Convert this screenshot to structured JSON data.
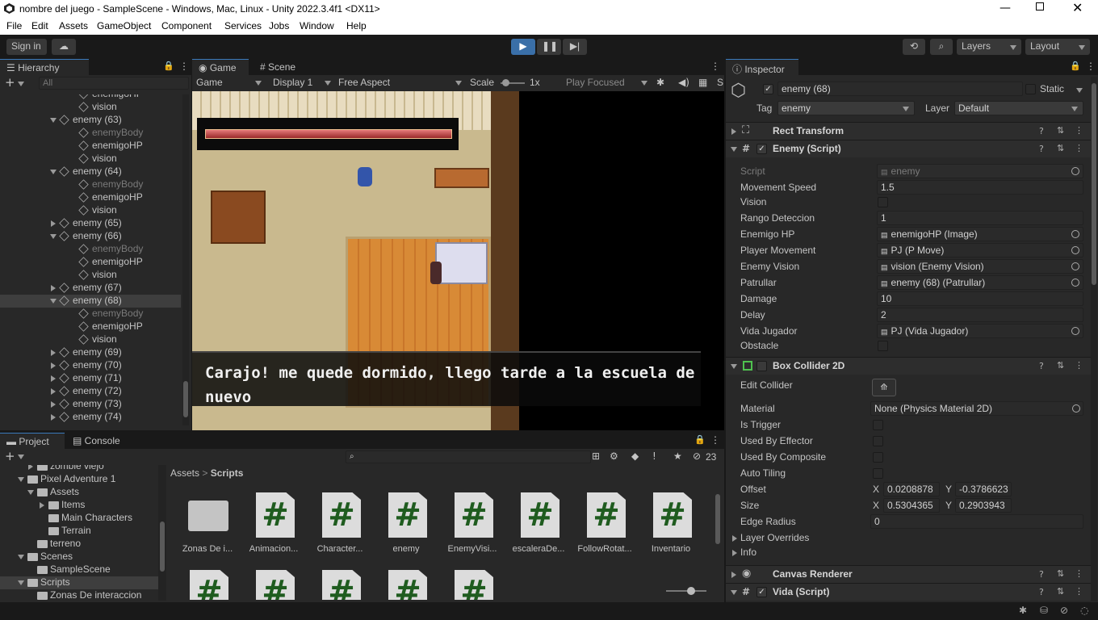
{
  "window": {
    "title": "nombre del juego - SampleScene - Windows, Mac, Linux - Unity 2022.3.4f1 <DX11>"
  },
  "menu": [
    "File",
    "Edit",
    "Assets",
    "GameObject",
    "Component",
    "Services",
    "Jobs",
    "Window",
    "Help"
  ],
  "toolbar": {
    "signin": "Sign in",
    "layers": "Layers",
    "layout": "Layout"
  },
  "hierarchy": {
    "tab": "Hierarchy",
    "search_placeholder": "All",
    "rows": [
      {
        "label": "enemigoHP",
        "indent": 2,
        "dim": false,
        "arrow": "none",
        "selected": false
      },
      {
        "label": "vision",
        "indent": 2,
        "dim": false,
        "arrow": "none",
        "selected": false
      },
      {
        "label": "enemy (63)",
        "indent": 1,
        "dim": false,
        "arrow": "down",
        "selected": false
      },
      {
        "label": "enemyBody",
        "indent": 2,
        "dim": true,
        "arrow": "none",
        "selected": false
      },
      {
        "label": "enemigoHP",
        "indent": 2,
        "dim": false,
        "arrow": "none",
        "selected": false
      },
      {
        "label": "vision",
        "indent": 2,
        "dim": false,
        "arrow": "none",
        "selected": false
      },
      {
        "label": "enemy (64)",
        "indent": 1,
        "dim": false,
        "arrow": "down",
        "selected": false
      },
      {
        "label": "enemyBody",
        "indent": 2,
        "dim": true,
        "arrow": "none",
        "selected": false
      },
      {
        "label": "enemigoHP",
        "indent": 2,
        "dim": false,
        "arrow": "none",
        "selected": false
      },
      {
        "label": "vision",
        "indent": 2,
        "dim": false,
        "arrow": "none",
        "selected": false
      },
      {
        "label": "enemy (65)",
        "indent": 1,
        "dim": false,
        "arrow": "right",
        "selected": false
      },
      {
        "label": "enemy (66)",
        "indent": 1,
        "dim": false,
        "arrow": "down",
        "selected": false
      },
      {
        "label": "enemyBody",
        "indent": 2,
        "dim": true,
        "arrow": "none",
        "selected": false
      },
      {
        "label": "enemigoHP",
        "indent": 2,
        "dim": false,
        "arrow": "none",
        "selected": false
      },
      {
        "label": "vision",
        "indent": 2,
        "dim": false,
        "arrow": "none",
        "selected": false
      },
      {
        "label": "enemy (67)",
        "indent": 1,
        "dim": false,
        "arrow": "right",
        "selected": false
      },
      {
        "label": "enemy (68)",
        "indent": 1,
        "dim": false,
        "arrow": "down",
        "selected": true
      },
      {
        "label": "enemyBody",
        "indent": 2,
        "dim": true,
        "arrow": "none",
        "selected": false
      },
      {
        "label": "enemigoHP",
        "indent": 2,
        "dim": false,
        "arrow": "none",
        "selected": false
      },
      {
        "label": "vision",
        "indent": 2,
        "dim": false,
        "arrow": "none",
        "selected": false
      },
      {
        "label": "enemy (69)",
        "indent": 1,
        "dim": false,
        "arrow": "right",
        "selected": false
      },
      {
        "label": "enemy (70)",
        "indent": 1,
        "dim": false,
        "arrow": "right",
        "selected": false
      },
      {
        "label": "enemy (71)",
        "indent": 1,
        "dim": false,
        "arrow": "right",
        "selected": false
      },
      {
        "label": "enemy (72)",
        "indent": 1,
        "dim": false,
        "arrow": "right",
        "selected": false
      },
      {
        "label": "enemy (73)",
        "indent": 1,
        "dim": false,
        "arrow": "right",
        "selected": false
      },
      {
        "label": "enemy (74)",
        "indent": 1,
        "dim": false,
        "arrow": "right",
        "selected": false
      }
    ]
  },
  "game": {
    "tabs": [
      "Game",
      "Scene"
    ],
    "display_mode": "Game",
    "display": "Display 1",
    "aspect": "Free Aspect",
    "scale_label": "Scale",
    "scale_value": "1x",
    "play_focused": "Play Focused",
    "stats_cut": "S",
    "dialog": "Carajo! me quede dormido, llego tarde a la escuela de nuevo"
  },
  "inspector": {
    "tab": "Inspector",
    "object_name": "enemy (68)",
    "static_label": "Static",
    "tag_label": "Tag",
    "tag": "enemy",
    "layer_label": "Layer",
    "layer": "Default",
    "components": {
      "rect": "Rect Transform",
      "enemy": "Enemy (Script)",
      "box": "Box Collider 2D",
      "canvas": "Canvas Renderer",
      "vida": "Vida (Script)"
    },
    "enemy_fields": [
      {
        "label": "Script",
        "value": "enemy",
        "kind": "ref",
        "dim": true
      },
      {
        "label": "Movement Speed",
        "value": "1.5",
        "kind": "text",
        "dim": false
      },
      {
        "label": "Vision",
        "value": "",
        "kind": "check",
        "dim": false
      },
      {
        "label": "Rango Deteccion",
        "value": "1",
        "kind": "text",
        "dim": false
      },
      {
        "label": "Enemigo HP",
        "value": "enemigoHP (Image)",
        "kind": "ref",
        "dim": false
      },
      {
        "label": "Player Movement",
        "value": "PJ (P Move)",
        "kind": "ref",
        "dim": false
      },
      {
        "label": "Enemy Vision",
        "value": "vision (Enemy Vision)",
        "kind": "ref",
        "dim": false
      },
      {
        "label": "Patrullar",
        "value": "enemy (68) (Patrullar)",
        "kind": "ref",
        "dim": false
      },
      {
        "label": "Damage",
        "value": "10",
        "kind": "text",
        "dim": false
      },
      {
        "label": "Delay",
        "value": "2",
        "kind": "text",
        "dim": false
      },
      {
        "label": "Vida Jugador",
        "value": "PJ (Vida Jugador)",
        "kind": "ref",
        "dim": false
      },
      {
        "label": "Obstacle",
        "value": "",
        "kind": "check",
        "dim": false
      }
    ],
    "box": {
      "edit_collider": "Edit Collider",
      "material_label": "Material",
      "material": "None (Physics Material 2D)",
      "is_trigger": "Is Trigger",
      "used_by_effector": "Used By Effector",
      "used_by_composite": "Used By Composite",
      "auto_tiling": "Auto Tiling",
      "offset_label": "Offset",
      "offset_x": "0.0208878",
      "offset_y": "-0.3786623",
      "size_label": "Size",
      "size_x": "0.5304365",
      "size_y": "0.2903943",
      "edge_label": "Edge Radius",
      "edge": "0",
      "layer_overrides": "Layer Overrides",
      "info": "Info",
      "x": "X",
      "y": "Y"
    }
  },
  "project": {
    "tabs": [
      "Project",
      "Console"
    ],
    "tree": [
      {
        "label": "zombie viejo",
        "indent": 2,
        "arrow": "right"
      },
      {
        "label": "Pixel Adventure 1",
        "indent": 1,
        "arrow": "down"
      },
      {
        "label": "Assets",
        "indent": 2,
        "arrow": "down"
      },
      {
        "label": "Items",
        "indent": 3,
        "arrow": "right"
      },
      {
        "label": "Main Characters",
        "indent": 3,
        "arrow": "none"
      },
      {
        "label": "Terrain",
        "indent": 3,
        "arrow": "none"
      },
      {
        "label": "terreno",
        "indent": 2,
        "arrow": "none"
      },
      {
        "label": "Scenes",
        "indent": 1,
        "arrow": "down"
      },
      {
        "label": "SampleScene",
        "indent": 2,
        "arrow": "none"
      },
      {
        "label": "Scripts",
        "indent": 1,
        "arrow": "down"
      },
      {
        "label": "Zonas De interaccion",
        "indent": 2,
        "arrow": "none"
      }
    ],
    "breadcrumb": [
      "Assets",
      "Scripts"
    ],
    "hidden_count": "23",
    "assets": [
      "Zonas De i...",
      "Animacion...",
      "Character...",
      "enemy",
      "EnemyVisi...",
      "escaleraDe...",
      "FollowRotat...",
      "Inventario"
    ],
    "icon_glyph": "#"
  }
}
